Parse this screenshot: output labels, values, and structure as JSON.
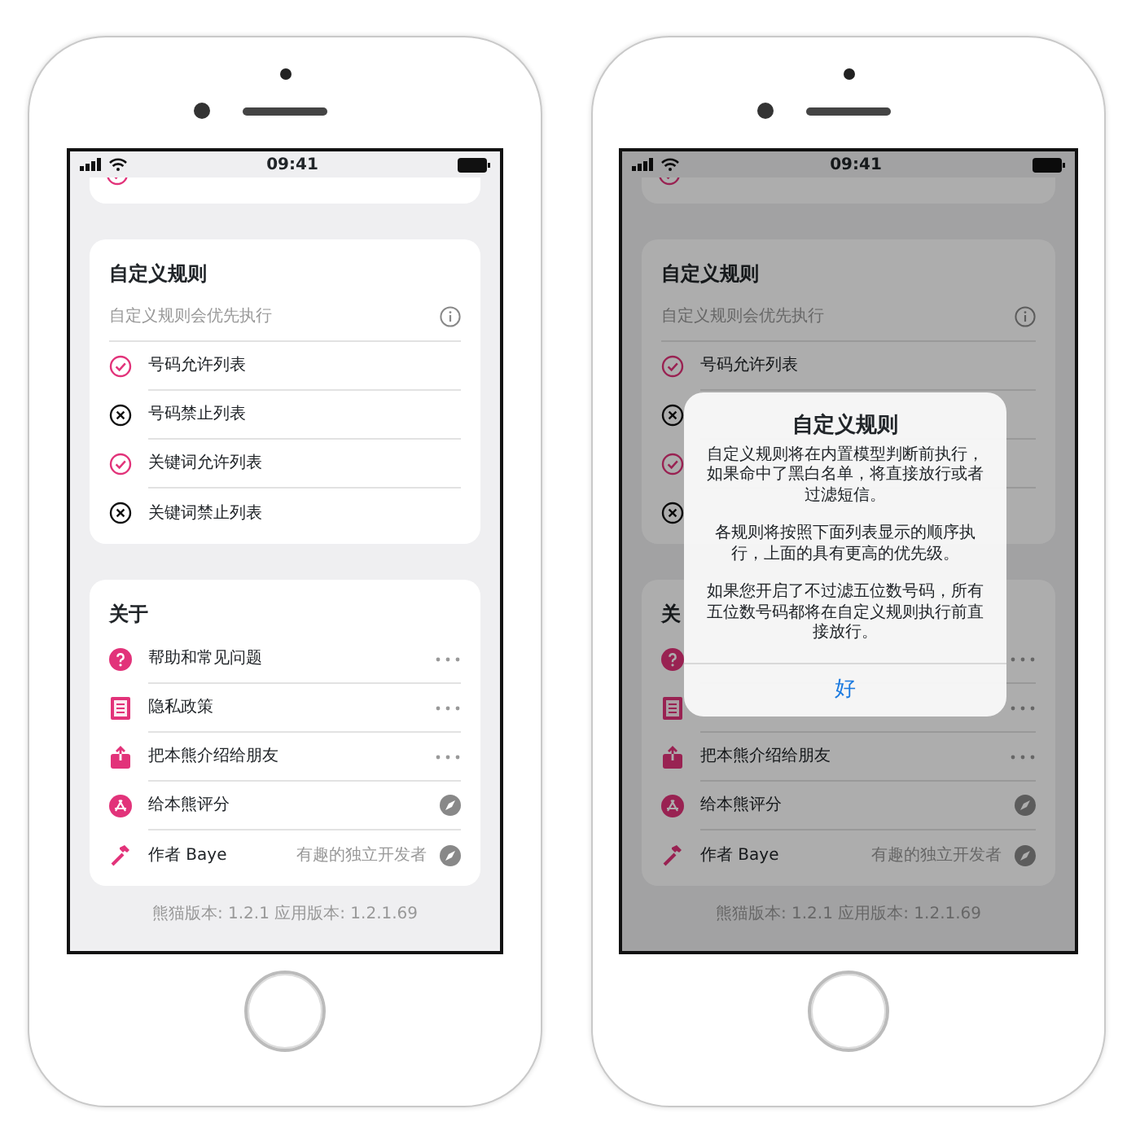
{
  "phones": [
    {
      "status": {
        "time": "09:41"
      },
      "dimmed": false,
      "rules_card": {
        "title": "自定义规则",
        "subtitle": "自定义规则会优先执行",
        "items": [
          {
            "kind": "allow",
            "label": "号码允许列表"
          },
          {
            "kind": "block",
            "label": "号码禁止列表"
          },
          {
            "kind": "allow",
            "label": "关键词允许列表"
          },
          {
            "kind": "block",
            "label": "关键词禁止列表"
          }
        ]
      },
      "about_card": {
        "title": "关于",
        "items": [
          {
            "kind": "help",
            "label": "帮助和常见问题",
            "accessory": {
              "kind": "more"
            }
          },
          {
            "kind": "document",
            "label": "隐私政策",
            "accessory": {
              "kind": "more"
            }
          },
          {
            "kind": "share",
            "label": "把本熊介绍给朋友",
            "accessory": {
              "kind": "more"
            }
          },
          {
            "kind": "appstore",
            "label": "给本熊评分",
            "accessory": {
              "kind": "link"
            }
          },
          {
            "kind": "hammer",
            "label": "作者 Baye",
            "detail": "有趣的独立开发者",
            "accessory": {
              "kind": "link"
            }
          }
        ]
      },
      "footer": "熊猫版本: 1.2.1 应用版本: 1.2.1.69"
    },
    {
      "status": {
        "time": "09:41"
      },
      "dimmed": true,
      "rules_card": {
        "title": "自定义规则",
        "subtitle": "自定义规则会优先执行",
        "items": [
          {
            "kind": "allow",
            "label": "号码允许列表"
          },
          {
            "kind": "block"
          },
          {
            "kind": "allow"
          },
          {
            "kind": "block"
          }
        ]
      },
      "about_card": {
        "title": "关",
        "items": [
          {
            "kind": "help",
            "accessory": {
              "kind": "more"
            }
          },
          {
            "kind": "document",
            "accessory": {
              "kind": "more"
            }
          },
          {
            "kind": "share",
            "label": "把本熊介绍给朋友",
            "accessory": {
              "kind": "more"
            }
          },
          {
            "kind": "appstore",
            "label": "给本熊评分",
            "accessory": {
              "kind": "link"
            }
          },
          {
            "kind": "hammer",
            "label": "作者 Baye",
            "detail": "有趣的独立开发者",
            "accessory": {
              "kind": "link"
            }
          }
        ]
      },
      "footer": "熊猫版本: 1.2.1 应用版本: 1.2.1.69",
      "alert": {
        "title": "自定义规则",
        "paragraphs": [
          "自定义规则将在内置模型判断前执行，如果命中了黑白名单，将直接放行或者过滤短信。",
          "各规则将按照下面列表显示的顺序执行，上面的具有更高的优先级。",
          "如果您开启了不过滤五位数号码，所有五位数号码都将在自定义规则执行前直接放行。"
        ],
        "button": "好"
      }
    }
  ]
}
